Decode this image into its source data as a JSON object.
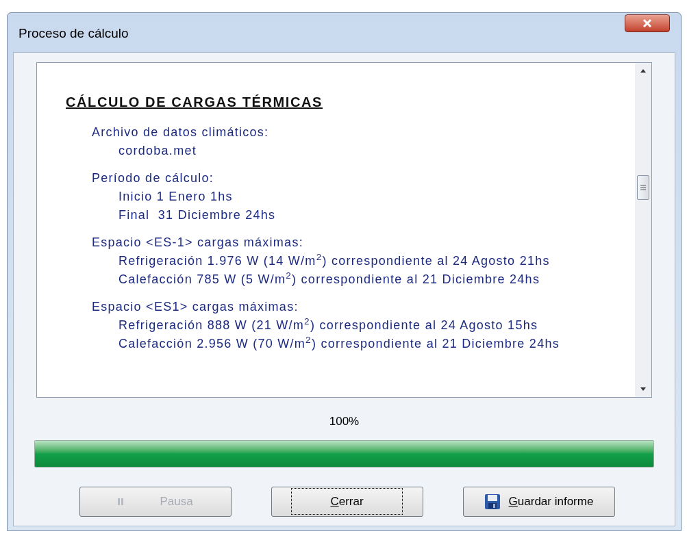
{
  "window": {
    "title": "Proceso de cálculo"
  },
  "report": {
    "heading": "CÁLCULO DE CARGAS TÉRMICAS",
    "groups": [
      {
        "label": "Archivo de datos climáticos:",
        "lines": [
          "cordoba.met"
        ]
      },
      {
        "label": "Período de cálculo:",
        "lines": [
          "Inicio 1 Enero 1hs",
          "Final  31 Diciembre 24hs"
        ]
      },
      {
        "label": "Espacio <ES-1> cargas máximas:",
        "lines": [
          "Refrigeración 1.976 W (14 W/m$^{2}$) correspondiente al 24 Agosto 21hs",
          "Calefacción 785 W (5 W/m$^{2}$) correspondiente al 21 Diciembre 24hs"
        ]
      },
      {
        "label": "Espacio <ES1> cargas máximas:",
        "lines": [
          "Refrigeración 888 W (21 W/m$^{2}$) correspondiente al 24 Agosto 15hs",
          "Calefacción 2.956 W (70 W/m$^{2}$) correspondiente al 21 Diciembre 24hs"
        ]
      }
    ]
  },
  "progress": {
    "reading": "100%",
    "level": 1
  },
  "buttons": [
    {
      "label": "Pausa",
      "kind": "pause",
      "disabled": true,
      "focused": false,
      "mnemonic": false
    },
    {
      "label": "Cerrar",
      "kind": "plain",
      "disabled": false,
      "focused": true,
      "mnemonic": true
    },
    {
      "label": "Guardar informe",
      "kind": "save",
      "disabled": false,
      "focused": false,
      "mnemonic": true
    }
  ]
}
